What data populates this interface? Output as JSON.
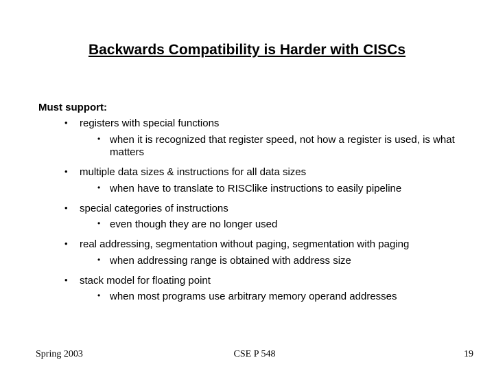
{
  "title": "Backwards Compatibility is Harder with CISCs",
  "lead": "Must support:",
  "items": [
    {
      "text": "registers with special functions",
      "sub": [
        "when it is recognized that register speed, not how a register is used, is what matters"
      ]
    },
    {
      "text": "multiple data sizes & instructions for all data sizes",
      "sub": [
        "when have to translate to RISClike instructions to easily pipeline"
      ]
    },
    {
      "text": "special categories of instructions",
      "sub": [
        "even though they are no longer used"
      ]
    },
    {
      "text": "real addressing, segmentation without paging, segmentation with paging",
      "sub": [
        "when addressing range is obtained with address size"
      ]
    },
    {
      "text": "stack model for floating point",
      "sub": [
        "when most programs use arbitrary memory operand addresses"
      ]
    }
  ],
  "footer": {
    "left": "Spring 2003",
    "center": "CSE P 548",
    "right": "19"
  }
}
